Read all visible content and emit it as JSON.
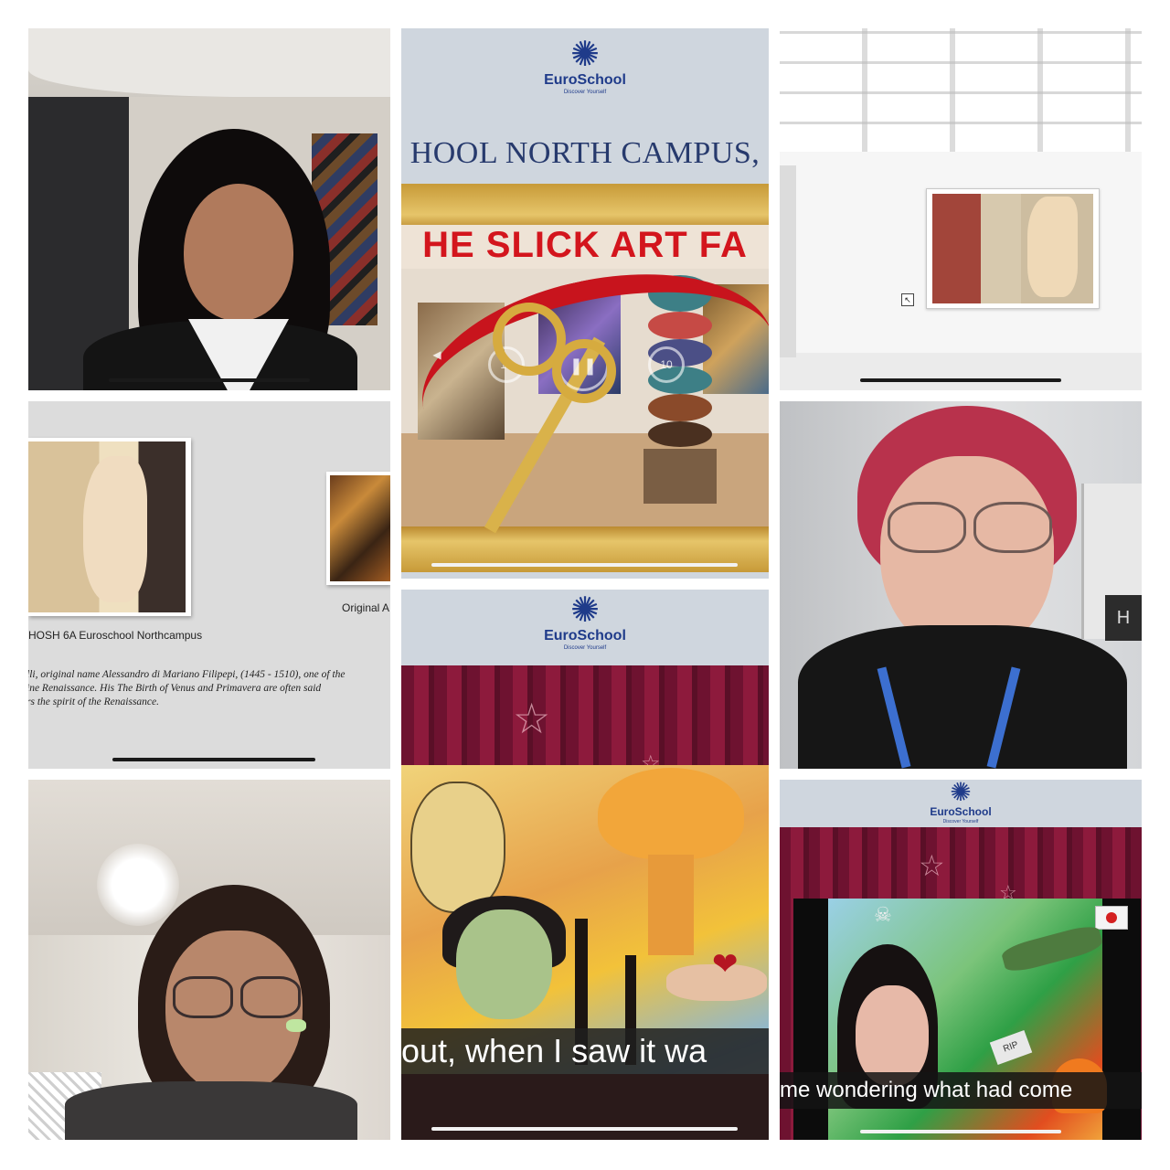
{
  "tiles": {
    "art_fair_video": {
      "logo": {
        "name": "EuroSchool",
        "tagline": "Discover Yourself",
        "icon": "snowflake-logo-icon"
      },
      "campus_banner": "HOOL NORTH CAMPUS,",
      "fair_title": "HE SLICK ART FA",
      "controls": {
        "rewind": "10",
        "forward": "10",
        "rewind_icon": "rewind-10-icon",
        "pause_icon": "pause-icon",
        "forward_icon": "forward-10-icon",
        "skip_back_icon": "skip-back-icon"
      }
    },
    "slide": {
      "original_label": "Original A",
      "credit": "HOSH  6A Euroschool Northcampus",
      "paragraph": [
        "lli, original name Alessandro di Mariano Filipepi, (1445 - 1510), one of the",
        "ine Renaissance. His The Birth of Venus and Primavera are often said",
        "rs the spirit of the Renaissance."
      ]
    },
    "stage_video": {
      "logo": {
        "name": "EuroSchool",
        "tagline": "Discover Yourself",
        "icon": "snowflake-logo-icon"
      },
      "subtitle": "out, when I saw it wa"
    },
    "hiroshima_video": {
      "logo": {
        "name": "EuroSchool",
        "tagline": "Discover Yourself",
        "icon": "snowflake-logo-icon"
      },
      "subtitle": "me wondering what had come",
      "painting_text": "RIP"
    },
    "gallery": {
      "cursor_icon": "pointer-cursor-icon"
    },
    "speaker_room": {
      "sign_letter": "H"
    }
  },
  "colors": {
    "euroschool_blue": "#1f3b8a",
    "fair_red": "#d3151d",
    "campus_text": "#273a6d"
  }
}
